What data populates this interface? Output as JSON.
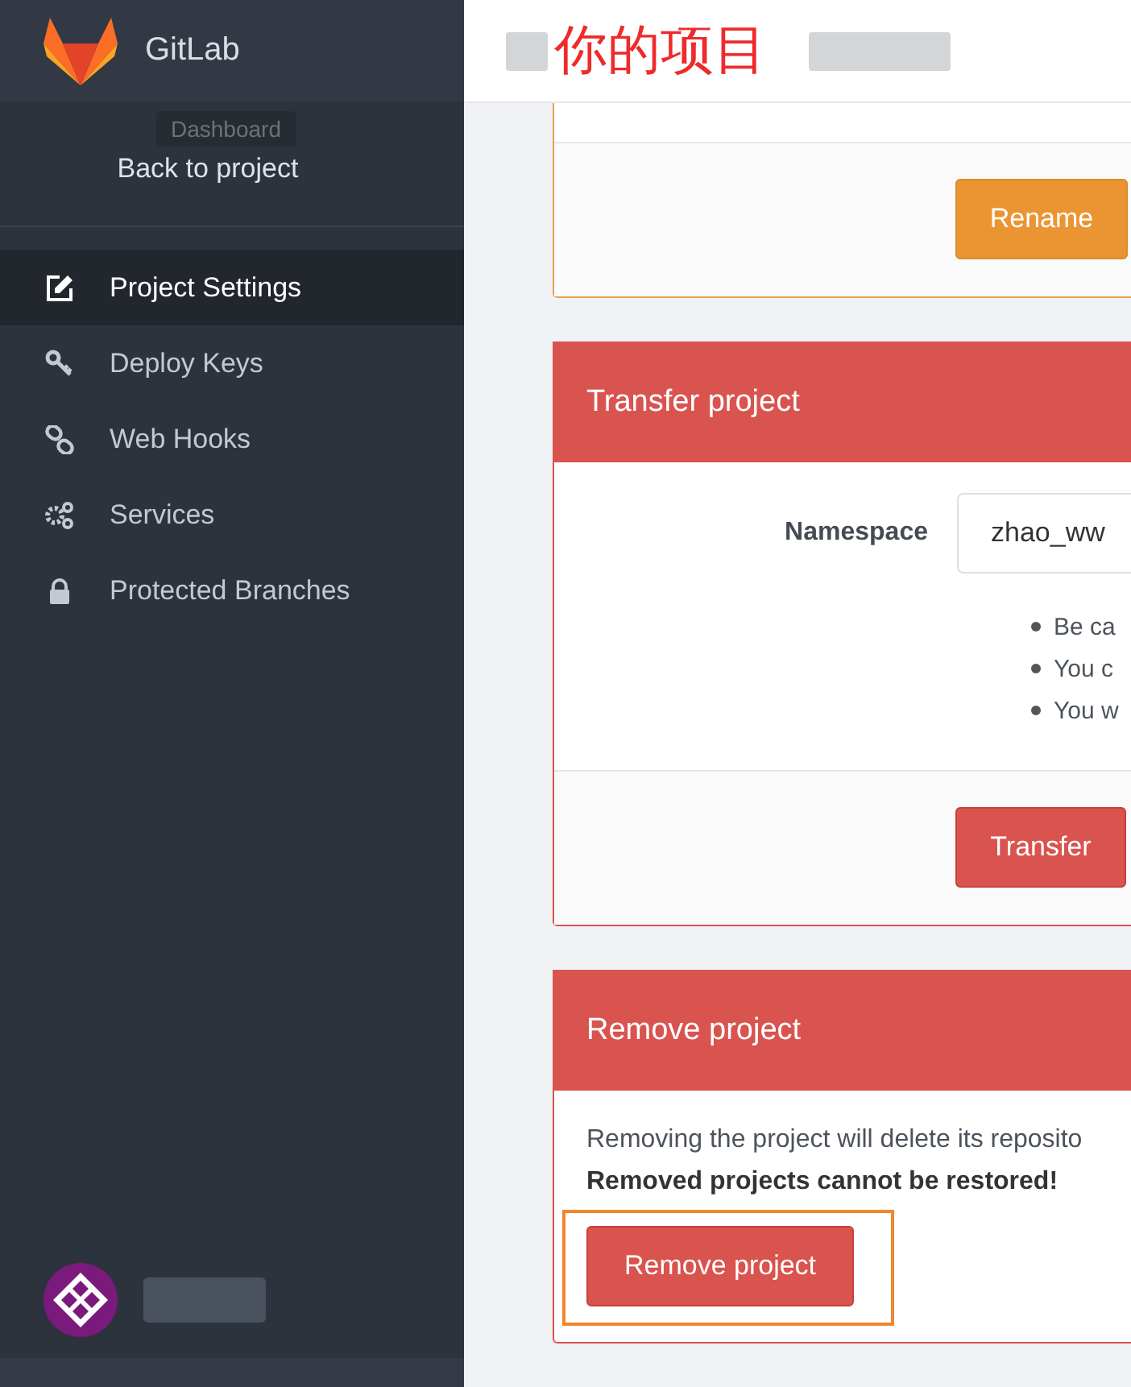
{
  "sidebar": {
    "brand": "GitLab",
    "tooltip": "Dashboard",
    "back_link": "Back to project",
    "items": [
      {
        "label": "Project Settings",
        "selected": true
      },
      {
        "label": "Deploy Keys",
        "selected": false
      },
      {
        "label": "Web Hooks",
        "selected": false
      },
      {
        "label": "Services",
        "selected": false
      },
      {
        "label": "Protected Branches",
        "selected": false
      }
    ]
  },
  "header": {
    "annotation": "你的项目"
  },
  "rename_panel": {
    "button": "Rename"
  },
  "transfer_panel": {
    "title": "Transfer project",
    "namespace_label": "Namespace",
    "namespace_value": "zhao_ww",
    "notes": [
      "Be ca",
      "You c",
      "You w"
    ],
    "button": "Transfer"
  },
  "remove_panel": {
    "title": "Remove project",
    "text": "Removing the project will delete its reposito",
    "warning": "Removed projects cannot be restored!",
    "button": "Remove project",
    "highlighted": true
  }
}
